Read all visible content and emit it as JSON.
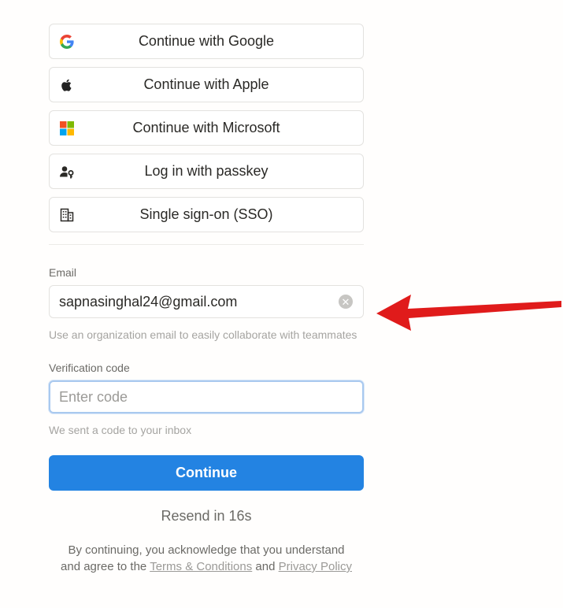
{
  "sso": {
    "google": "Continue with Google",
    "apple": "Continue with Apple",
    "microsoft": "Continue with Microsoft",
    "passkey": "Log in with passkey",
    "sso": "Single sign-on (SSO)"
  },
  "email": {
    "label": "Email",
    "value": "sapnasinghal24@gmail.com",
    "hint": "Use an organization email to easily collaborate with teammates"
  },
  "code": {
    "label": "Verification code",
    "placeholder": "Enter code",
    "hint": "We sent a code to your inbox"
  },
  "continue_label": "Continue",
  "resend": "Resend in 16s",
  "legal": {
    "line1": "By continuing, you acknowledge that you understand",
    "line2_prefix": "and agree to the",
    "terms": "Terms & Conditions",
    "and": "and",
    "privacy": "Privacy Policy"
  },
  "colors": {
    "primary": "#2383e2",
    "annotation_arrow": "#e01b1b"
  },
  "icons": {
    "google": "google-icon",
    "apple": "apple-icon",
    "microsoft": "microsoft-icon",
    "passkey": "passkey-icon",
    "sso": "building-icon",
    "clear": "clear-icon",
    "arrow": "red-arrow-icon"
  }
}
